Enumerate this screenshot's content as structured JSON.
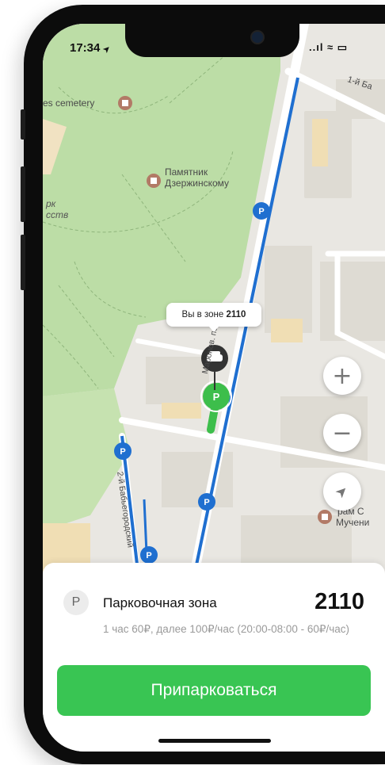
{
  "status_bar": {
    "time": "17:34",
    "location_arrow": "➤",
    "icons": "..ıl ≈ ▭"
  },
  "map": {
    "labels": {
      "cemetery": "es cemetery",
      "monument_line1": "Памятник",
      "monument_line2": "Дзержинскому",
      "park_line1": "рк",
      "park_line2": "сств",
      "street_top": "1-й Ба",
      "street_maronovsky": "Маронов. пер.",
      "street_babegorodsky": "2-й Бабьегородский",
      "temple_line1": "рам С",
      "temple_line2": "Мучени"
    },
    "callout": {
      "prefix": "Вы в зоне",
      "zone": "2110"
    },
    "parking_marker": "P",
    "controls": {
      "zoom_in": "+",
      "zoom_out": "−",
      "locate": "➤"
    },
    "colors": {
      "park_green": "#b8dca0",
      "road_blue": "#1f6fd0",
      "parking_green": "#3dbe4b",
      "building": "#dedbd3",
      "building_yellow": "#f0deb4"
    }
  },
  "sheet": {
    "badge": "P",
    "title": "Парковочная зона",
    "zone_number": "2110",
    "tariff": "1 час 60₽, далее 100₽/час (20:00-08:00 - 60₽/час)",
    "park_button": "Припарковаться",
    "colors": {
      "accent": "#39c553"
    }
  }
}
